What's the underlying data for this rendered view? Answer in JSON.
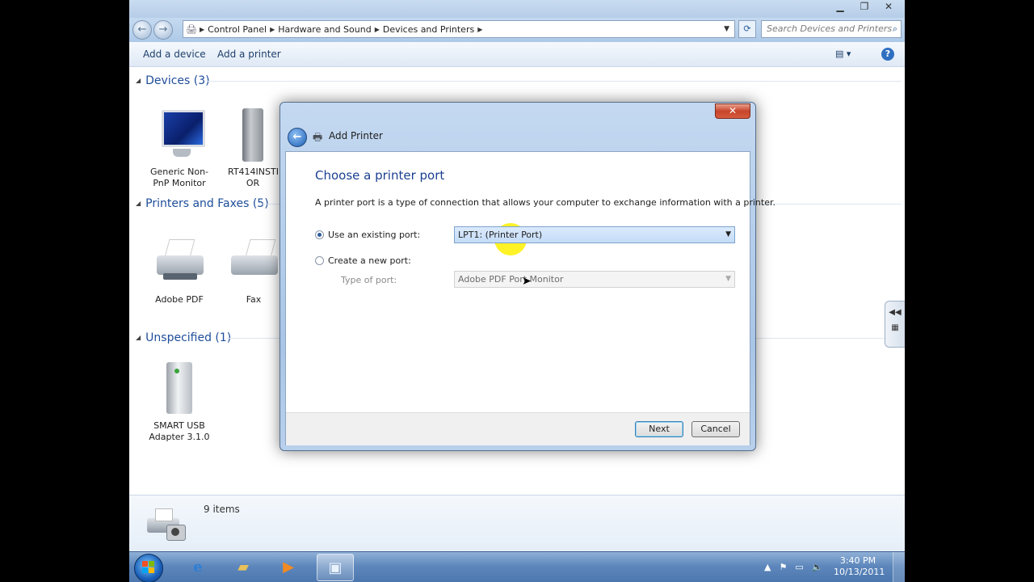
{
  "explorer": {
    "breadcrumbs": [
      "Control Panel",
      "Hardware and Sound",
      "Devices and Printers"
    ],
    "search_placeholder": "Search Devices and Printers",
    "commands": [
      "Add a device",
      "Add a printer"
    ]
  },
  "groups": [
    {
      "title": "Devices (3)",
      "items": [
        {
          "label": "Generic Non-PnP Monitor",
          "icon": "monitor-icon"
        },
        {
          "label": "RT414INSTR OR",
          "icon": "drive-icon"
        }
      ]
    },
    {
      "title": "Printers and Faxes (5)",
      "items": [
        {
          "label": "Adobe PDF",
          "icon": "printer-icon"
        },
        {
          "label": "Fax",
          "icon": "fax-icon"
        }
      ]
    },
    {
      "title": "Unspecified (1)",
      "items": [
        {
          "label": "SMART USB Adapter 3.1.0",
          "icon": "usb-device-icon"
        }
      ]
    }
  ],
  "details": {
    "count": "9 items"
  },
  "dialog": {
    "title": "Add Printer",
    "heading": "Choose a printer port",
    "description": "A printer port is a type of connection that allows your computer to exchange information with a printer.",
    "option_existing": "Use an existing port:",
    "existing_value": "LPT1: (Printer Port)",
    "option_new": "Create a new port:",
    "type_label": "Type of port:",
    "type_value": "Adobe PDF Port Monitor",
    "selected_option": "existing",
    "next": "Next",
    "cancel": "Cancel"
  },
  "taskbar": {
    "items": [
      "start-button",
      "internet-explorer-icon",
      "windows-explorer-icon",
      "media-player-icon",
      "devices-and-printers-icon"
    ],
    "time": "3:40 PM",
    "date": "10/13/2011"
  }
}
